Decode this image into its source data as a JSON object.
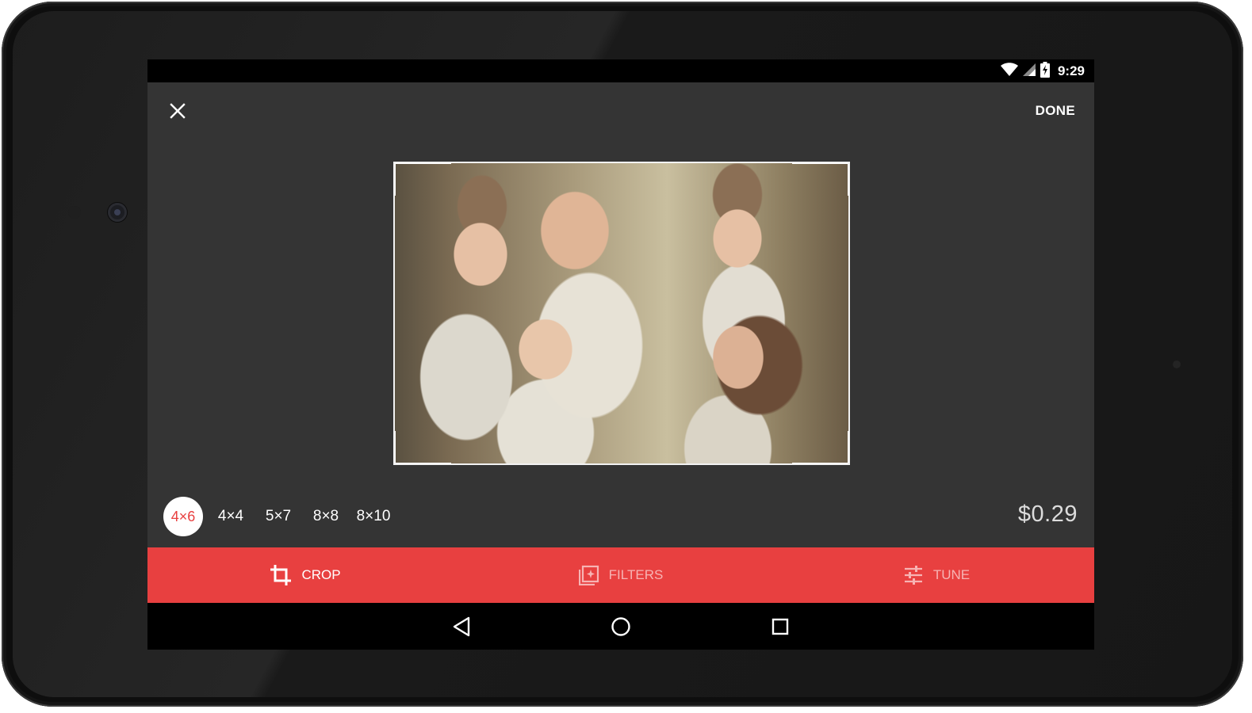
{
  "status_bar": {
    "time": "9:29"
  },
  "top_bar": {
    "done_label": "DONE"
  },
  "sizes": [
    {
      "label": "4×6",
      "selected": true
    },
    {
      "label": "4×4",
      "selected": false
    },
    {
      "label": "5×7",
      "selected": false
    },
    {
      "label": "8×8",
      "selected": false
    },
    {
      "label": "8×10",
      "selected": false
    }
  ],
  "price": "$0.29",
  "tabs": [
    {
      "label": "CROP",
      "icon": "crop-icon",
      "active": true
    },
    {
      "label": "FILTERS",
      "icon": "filters-icon",
      "active": false
    },
    {
      "label": "TUNE",
      "icon": "tune-icon",
      "active": false
    }
  ],
  "navigation": {
    "icons": [
      "back-icon",
      "home-icon",
      "recents-icon"
    ]
  },
  "colors": {
    "accent": "#e84040",
    "screen_background": "#343434",
    "status_bar": "#000000",
    "inactive_tab_text": "#f7b3b3"
  }
}
